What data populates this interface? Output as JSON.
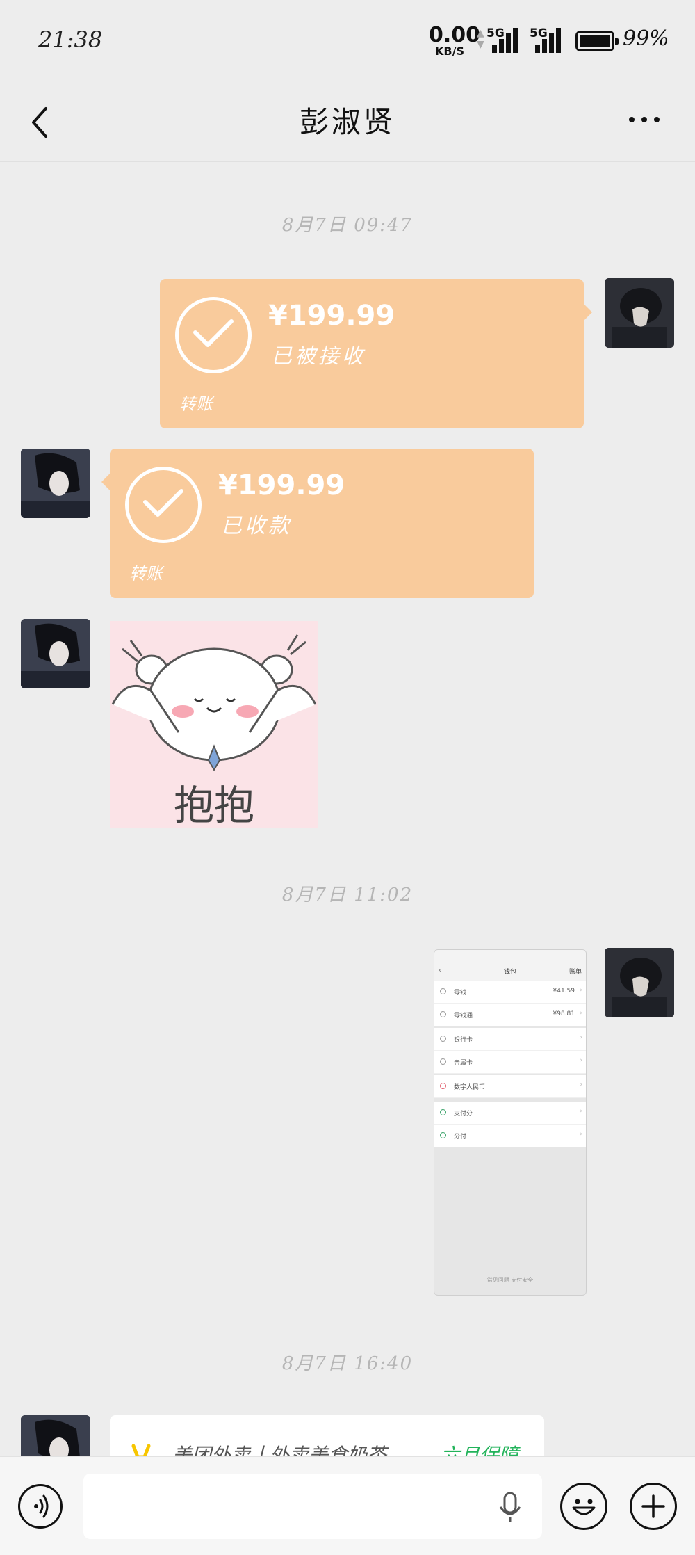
{
  "status_bar": {
    "time": "21:38",
    "net_speed_value": "0.00",
    "net_speed_unit": "KB/S",
    "signal_1_label": "5G",
    "signal_2_label": "5G",
    "battery_percent": "99%"
  },
  "nav": {
    "title": "彭淑贤",
    "back_icon": "chevron-left-icon",
    "more_icon": "more-dots-icon"
  },
  "messages": {
    "ts1": "8月7日 09:47",
    "transfer_sent": {
      "amount": "¥199.99",
      "status": "已被接收",
      "label": "转账"
    },
    "transfer_received": {
      "amount": "¥199.99",
      "status": "已收款",
      "label": "转账"
    },
    "sticker_text": "抱抱",
    "ts2": "8月7日 11:02",
    "ts3": "8月7日 16:40",
    "link_card": {
      "title": "美团外卖丨外卖美食奶茶…",
      "badge": "六月保障"
    }
  },
  "screenshot_thumb": {
    "header_title": "钱包",
    "header_right": "账单",
    "rows_group1": [
      {
        "label": "零钱",
        "value": "¥41.59"
      },
      {
        "label": "零钱通",
        "value": "¥98.81"
      }
    ],
    "rows_group2": [
      {
        "label": "银行卡",
        "value": ""
      },
      {
        "label": "亲属卡",
        "value": ""
      }
    ],
    "rows_group3": [
      {
        "label": "数字人民币",
        "value": ""
      }
    ],
    "rows_group4": [
      {
        "label": "支付分",
        "value": ""
      },
      {
        "label": "分付",
        "value": ""
      }
    ],
    "footer": "常见问题  支付安全"
  },
  "colors": {
    "background": "#ededed",
    "transfer_bubble": "#f9cb9c",
    "card_green": "#22b35a"
  }
}
